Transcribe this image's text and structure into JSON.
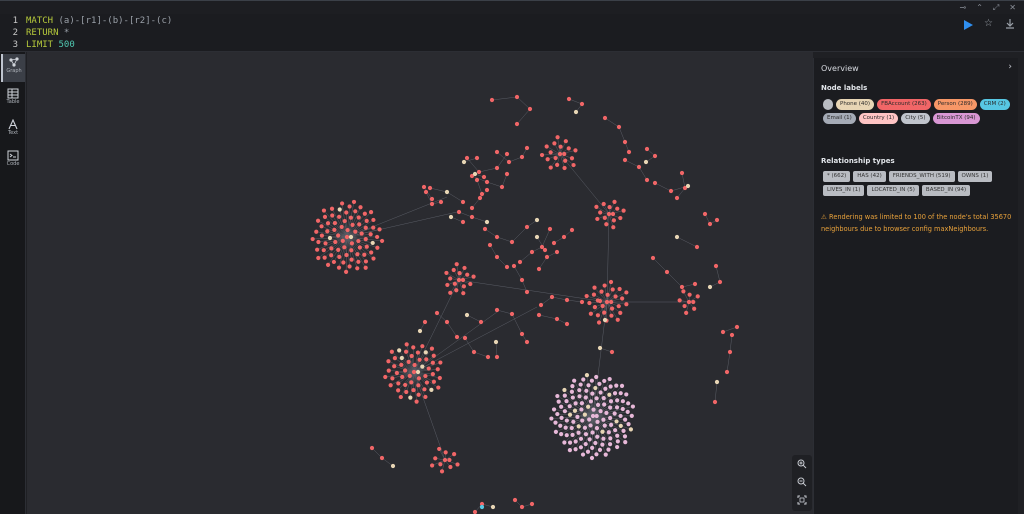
{
  "editor": {
    "lines": [
      {
        "num": "1",
        "segments": [
          {
            "t": "MATCH",
            "c": "kw"
          },
          {
            "t": " (a)-[r1]-(b)-[r2]-(c)",
            "c": "tok"
          }
        ]
      },
      {
        "num": "2",
        "segments": [
          {
            "t": "RETURN",
            "c": "kw"
          },
          {
            "t": " *",
            "c": "tok"
          }
        ]
      },
      {
        "num": "3",
        "segments": [
          {
            "t": "LIMIT",
            "c": "kw"
          },
          {
            "t": " 500",
            "c": "num"
          }
        ]
      }
    ]
  },
  "sidebar": {
    "items": [
      {
        "label": "Graph",
        "icon": "graph-icon",
        "active": true
      },
      {
        "label": "Table",
        "icon": "table-icon",
        "active": false
      },
      {
        "label": "Text",
        "icon": "text-icon",
        "active": false
      },
      {
        "label": "Code",
        "icon": "code-icon",
        "active": false
      }
    ]
  },
  "overview": {
    "title": "Overview",
    "node_labels_heading": "Node labels",
    "node_labels": [
      {
        "label": "*",
        "color": "#b9bcc2",
        "star": true
      },
      {
        "label": "Phone (40)",
        "color": "#e8d6b5"
      },
      {
        "label": "FBAccount (263)",
        "color": "#f16667"
      },
      {
        "label": "Person (289)",
        "color": "#f79767"
      },
      {
        "label": "CRM (2)",
        "color": "#57c7e3"
      },
      {
        "label": "Email (1)",
        "color": "#a5abb6"
      },
      {
        "label": "Country (1)",
        "color": "#ffc4c4"
      },
      {
        "label": "City (5)",
        "color": "#c0c4cc"
      },
      {
        "label": "BitcoinTX (94)",
        "color": "#d997d4"
      }
    ],
    "relationship_types_heading": "Relationship types",
    "relationship_types": [
      "* (662)",
      "HAS (42)",
      "FRIENDS_WITH (519)",
      "OWNS (1)",
      "LIVES_IN (1)",
      "LOCATED_IN (5)",
      "BASED_IN (94)"
    ],
    "warning": "Rendering was limited to 100 of the node's total 35670 neighbours due to browser config maxNeighbours."
  },
  "colors": {
    "node_red": "#f16667",
    "node_pink": "#e7b8d8",
    "node_cream": "#e8d6b5",
    "node_cyan": "#57c7e3",
    "edge": "#5a5d66",
    "warning": "#e9a23b"
  }
}
